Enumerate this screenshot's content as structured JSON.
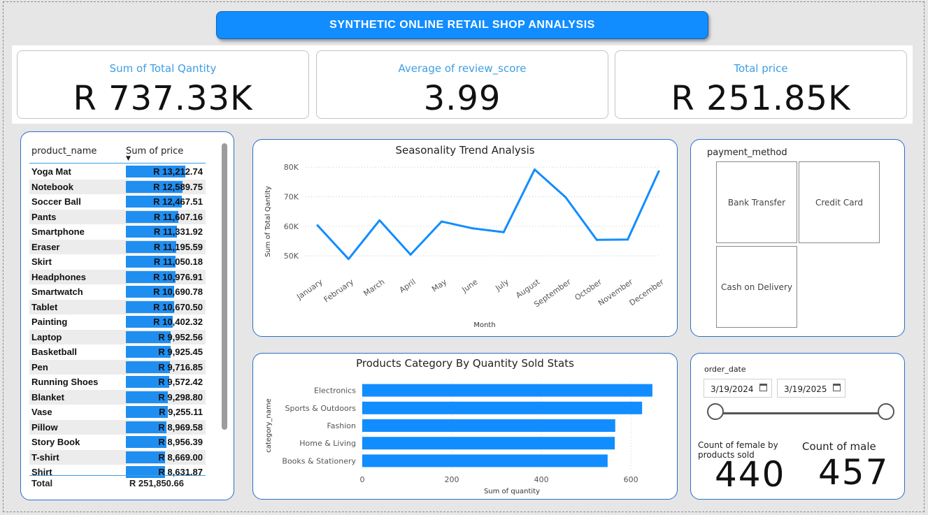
{
  "title": "SYNTHETIC ONLINE RETAIL SHOP ANNALYSIS",
  "kpis": [
    {
      "label": "Sum of Total Qantity",
      "value": "R 737.33K"
    },
    {
      "label": "Average of review_score",
      "value": "3.99"
    },
    {
      "label": "Total price",
      "value": "R 251.85K"
    }
  ],
  "product_table": {
    "col_name": "product_name",
    "col_price": "Sum of price",
    "total_label": "Total",
    "total_value": "R 251,850.66",
    "bar_max": 13212.74,
    "rows": [
      {
        "name": "Yoga Mat",
        "value": 13212.74,
        "display": "R 13,212.74"
      },
      {
        "name": "Notebook",
        "value": 12589.75,
        "display": "R 12,589.75"
      },
      {
        "name": "Soccer Ball",
        "value": 12467.51,
        "display": "R 12,467.51"
      },
      {
        "name": "Pants",
        "value": 11607.16,
        "display": "R 11,607.16"
      },
      {
        "name": "Smartphone",
        "value": 11331.92,
        "display": "R 11,331.92"
      },
      {
        "name": "Eraser",
        "value": 11195.59,
        "display": "R 11,195.59"
      },
      {
        "name": "Skirt",
        "value": 11050.18,
        "display": "R 11,050.18"
      },
      {
        "name": "Headphones",
        "value": 10976.91,
        "display": "R 10,976.91"
      },
      {
        "name": "Smartwatch",
        "value": 10690.78,
        "display": "R 10,690.78"
      },
      {
        "name": "Tablet",
        "value": 10670.5,
        "display": "R 10,670.50"
      },
      {
        "name": "Painting",
        "value": 10402.32,
        "display": "R 10,402.32"
      },
      {
        "name": "Laptop",
        "value": 9952.56,
        "display": "R 9,952.56"
      },
      {
        "name": "Basketball",
        "value": 9925.45,
        "display": "R 9,925.45"
      },
      {
        "name": "Pen",
        "value": 9716.85,
        "display": "R 9,716.85"
      },
      {
        "name": "Running Shoes",
        "value": 9572.42,
        "display": "R 9,572.42"
      },
      {
        "name": "Blanket",
        "value": 9298.8,
        "display": "R 9,298.80"
      },
      {
        "name": "Vase",
        "value": 9255.11,
        "display": "R 9,255.11"
      },
      {
        "name": "Pillow",
        "value": 8969.58,
        "display": "R 8,969.58"
      },
      {
        "name": "Story Book",
        "value": 8956.39,
        "display": "R 8,956.39"
      },
      {
        "name": "T-shirt",
        "value": 8669.0,
        "display": "R 8,669.00"
      },
      {
        "name": "Shirt",
        "value": 8631.87,
        "display": "R 8,631.87"
      }
    ]
  },
  "chart_data": [
    {
      "type": "line",
      "title": "Seasonality Trend Analysis",
      "xlabel": "Month",
      "ylabel": "Sum of Total Qantity",
      "x": [
        "January",
        "February",
        "March",
        "April",
        "May",
        "June",
        "July",
        "August",
        "September",
        "October",
        "November",
        "December"
      ],
      "series": [
        {
          "values": [
            60300,
            48900,
            62000,
            50400,
            61600,
            59300,
            58000,
            79200,
            69800,
            55400,
            55500,
            78600
          ]
        }
      ],
      "yticks": [
        50000,
        60000,
        70000,
        80000
      ],
      "ytick_labels": [
        "50K",
        "60K",
        "70K",
        "80K"
      ],
      "ylim": [
        46000,
        81000
      ],
      "grid": true,
      "color": "#118dff"
    },
    {
      "type": "bar",
      "orientation": "horizontal",
      "title": "Products Category By Quantity Sold Stats",
      "xlabel": "Sum of quantity",
      "ylabel": "category_name",
      "categories": [
        "Electronics",
        "Sports & Outdoors",
        "Fashion",
        "Home & Living",
        "Books & Stationery"
      ],
      "values": [
        648,
        625,
        565,
        564,
        548
      ],
      "xticks": [
        0,
        200,
        400,
        600
      ],
      "xlim": [
        0,
        670
      ],
      "grid": true,
      "color": "#118dff"
    }
  ],
  "payment": {
    "title": "payment_method",
    "options": [
      "Bank Transfer",
      "Credit Card",
      "Cash on Delivery"
    ]
  },
  "order_date": {
    "title": "order_date",
    "start": "3/19/2024",
    "end": "3/19/2025"
  },
  "counts": {
    "female_label": "Count of female by products sold",
    "female_value": "440",
    "male_label": "Count of male",
    "male_value": "457"
  }
}
